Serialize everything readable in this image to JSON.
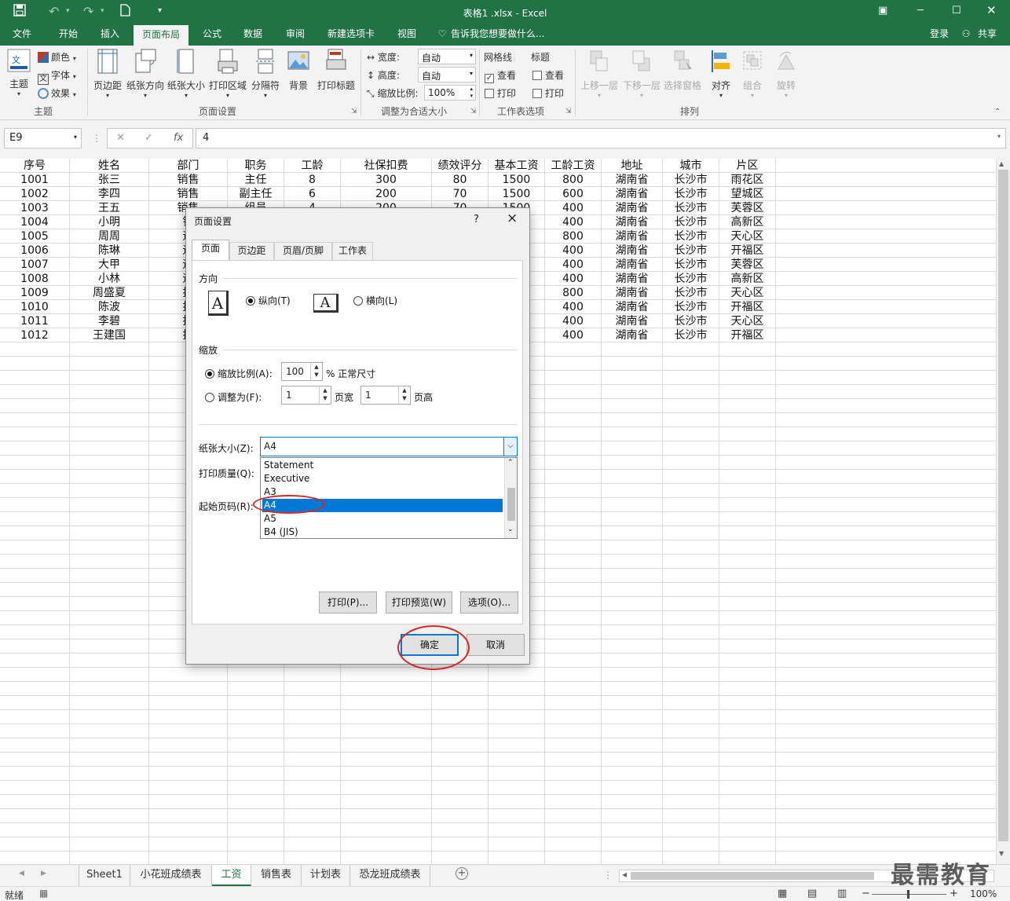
{
  "window": {
    "title": "表格1 .xlsx - Excel",
    "login": "登录",
    "share": "共享"
  },
  "ribbon_tabs": [
    "文件",
    "开始",
    "插入",
    "页面布局",
    "公式",
    "数据",
    "审阅",
    "新建选项卡",
    "视图"
  ],
  "tell_me": "告诉我您想要做什么...",
  "ribbon": {
    "theme": {
      "themes": "主题",
      "colors": "颜色",
      "fonts": "字体",
      "effects": "效果",
      "group": "主题"
    },
    "page_setup": {
      "margins": "页边距",
      "orientation": "纸张方向",
      "size": "纸张大小",
      "print_area": "打印区域",
      "breaks": "分隔符",
      "background": "背景",
      "print_titles": "打印标题",
      "group": "页面设置"
    },
    "scale": {
      "width_label": "宽度:",
      "width_value": "自动",
      "height_label": "高度:",
      "height_value": "自动",
      "scale_label": "缩放比例:",
      "scale_value": "100%",
      "group": "调整为合适大小"
    },
    "sheet_options": {
      "gridlines": "网格线",
      "headings": "标题",
      "view": "查看",
      "print": "打印",
      "group": "工作表选项"
    },
    "arrange": {
      "forward": "上移一层",
      "backward": "下移一层",
      "selection_pane": "选择窗格",
      "align": "对齐",
      "group_btn": "组合",
      "rotate": "旋转",
      "group": "排列"
    }
  },
  "formula_bar": {
    "name_box": "E9",
    "fx": "fx",
    "value": "4"
  },
  "table": {
    "headers": [
      "序号",
      "姓名",
      "部门",
      "职务",
      "工龄",
      "社保扣费",
      "绩效评分",
      "基本工资",
      "工龄工资",
      "地址",
      "城市",
      "片区"
    ],
    "rows": [
      [
        "1001",
        "张三",
        "销售",
        "主任",
        "8",
        "300",
        "80",
        "1500",
        "800",
        "湖南省",
        "长沙市",
        "雨花区"
      ],
      [
        "1002",
        "李四",
        "销售",
        "副主任",
        "6",
        "200",
        "70",
        "1500",
        "600",
        "湖南省",
        "长沙市",
        "望城区"
      ],
      [
        "1003",
        "王五",
        "销售",
        "组员",
        "4",
        "200",
        "70",
        "1500",
        "400",
        "湖南省",
        "长沙市",
        "芙蓉区"
      ],
      [
        "1004",
        "小明",
        "销",
        "",
        "",
        "",
        "",
        "",
        "400",
        "湖南省",
        "长沙市",
        "高新区"
      ],
      [
        "1005",
        "周周",
        "运",
        "",
        "",
        "",
        "",
        "",
        "800",
        "湖南省",
        "长沙市",
        "天心区"
      ],
      [
        "1006",
        "陈琳",
        "运",
        "",
        "",
        "",
        "",
        "",
        "400",
        "湖南省",
        "长沙市",
        "开福区"
      ],
      [
        "1007",
        "大甲",
        "运",
        "",
        "",
        "",
        "",
        "",
        "400",
        "湖南省",
        "长沙市",
        "芙蓉区"
      ],
      [
        "1008",
        "小林",
        "运",
        "",
        "",
        "",
        "",
        "",
        "400",
        "湖南省",
        "长沙市",
        "高新区"
      ],
      [
        "1009",
        "周盛夏",
        "技",
        "",
        "",
        "",
        "",
        "",
        "800",
        "湖南省",
        "长沙市",
        "天心区"
      ],
      [
        "1010",
        "陈波",
        "技",
        "",
        "",
        "",
        "",
        "",
        "400",
        "湖南省",
        "长沙市",
        "开福区"
      ],
      [
        "1011",
        "李碧",
        "技",
        "",
        "",
        "",
        "",
        "",
        "400",
        "湖南省",
        "长沙市",
        "天心区"
      ],
      [
        "1012",
        "王建国",
        "技",
        "",
        "",
        "",
        "",
        "",
        "400",
        "湖南省",
        "长沙市",
        "开福区"
      ]
    ]
  },
  "dialog": {
    "title": "页面设置",
    "help": "?",
    "close": "×",
    "tabs": [
      "页面",
      "页边距",
      "页眉/页脚",
      "工作表"
    ],
    "orientation_label": "方向",
    "portrait": "纵向(T)",
    "landscape": "横向(L)",
    "icon_letter": "A",
    "scaling_label": "缩放",
    "adjust_ratio": "缩放比例(A):",
    "ratio_value": "100",
    "normal_size": "% 正常尺寸",
    "fit_to": "调整为(F):",
    "fit_w": "1",
    "page_wide": "页宽",
    "fit_h": "1",
    "page_tall": "页高",
    "paper_size_label": "纸张大小(Z):",
    "paper_size_value": "A4",
    "print_quality_label": "打印质量(Q):",
    "first_page_label": "起始页码(R):",
    "paper_options": [
      "Statement",
      "Executive",
      "A3",
      "A4",
      "A5",
      "B4 (JIS)"
    ],
    "selected_option": "A4",
    "print_btn": "打印(P)...",
    "preview_btn": "打印预览(W)",
    "options_btn": "选项(O)...",
    "ok": "确定",
    "cancel": "取消"
  },
  "sheet_tabs": [
    "Sheet1",
    "小花班成绩表",
    "工资",
    "销售表",
    "计划表",
    "恐龙班成绩表"
  ],
  "active_sheet": "工资",
  "status": {
    "ready": "就绪",
    "zoom": "100%"
  },
  "watermark": "最需教育",
  "colors": {
    "excel_green": "#217346",
    "selection_blue": "#0078d7",
    "annotation_red": "#d62828"
  }
}
